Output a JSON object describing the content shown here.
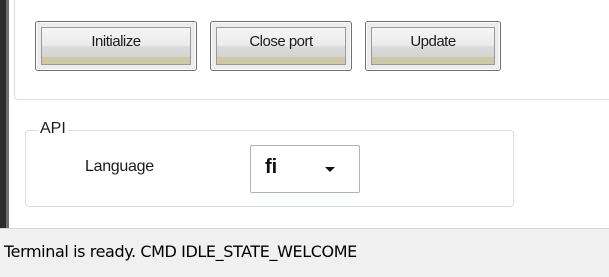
{
  "toolbar": {
    "initialize_label": "Initialize",
    "close_port_label": "Close port",
    "update_label": "Update"
  },
  "api_group": {
    "legend": "API",
    "language_label": "Language",
    "language_value": "fi"
  },
  "status_bar": {
    "text": "Terminal is ready.  CMD IDLE_STATE_WELCOME"
  },
  "colors": {
    "button_bottom_band": "#ccc8a8",
    "group_border": "#d5dfe5",
    "status_bar_bg": "#f0f0f0"
  }
}
